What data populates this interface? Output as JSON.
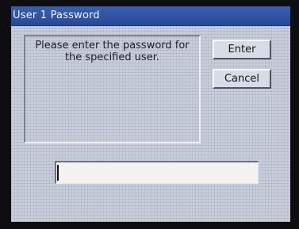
{
  "window": {
    "title": "User 1 Password"
  },
  "message": {
    "text": "Please enter the password for the specified user."
  },
  "buttons": {
    "enter_label": "Enter",
    "cancel_label": "Cancel"
  },
  "password_field": {
    "value": ""
  },
  "colors": {
    "titlebar": "#274a98",
    "titlebar_text": "#f1f4fb",
    "background": "#c7cdd9",
    "field_background": "#f3f2ee"
  }
}
